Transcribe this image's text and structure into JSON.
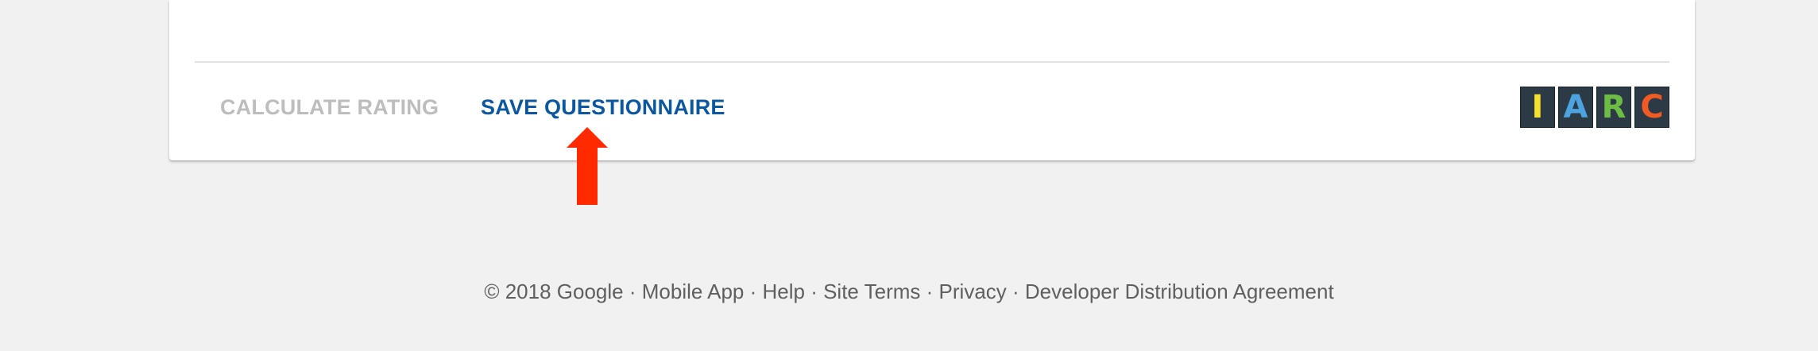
{
  "actions": {
    "calculate_label": "CALCULATE RATING",
    "save_label": "SAVE QUESTIONNAIRE"
  },
  "iarc_logo": {
    "letters": [
      "I",
      "A",
      "R",
      "C"
    ],
    "letter_colors": [
      "#f5e12c",
      "#4da3e0",
      "#6dbd45",
      "#f05a23"
    ],
    "tile_color": "#2c3a45"
  },
  "annotation": {
    "icon": "red-arrow-up-icon",
    "color": "#ff2a00"
  },
  "footer": {
    "copyright": "© 2018 Google",
    "separator": " · ",
    "links": [
      "Mobile App",
      "Help",
      "Site Terms",
      "Privacy",
      "Developer Distribution Agreement"
    ]
  },
  "colors": {
    "page_background": "#f1f1f1",
    "card_background": "#ffffff",
    "primary_action": "#0b57a0",
    "disabled_action": "#bdbdbd",
    "footer_text": "#5f5f5f"
  }
}
